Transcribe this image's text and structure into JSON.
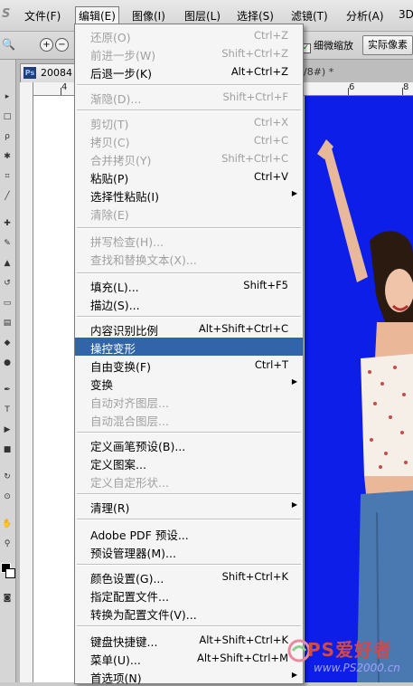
{
  "menubar": {
    "app_logo": "S",
    "items": [
      {
        "label": "文件(F)"
      },
      {
        "label": "编辑(E)"
      },
      {
        "label": "图像(I)"
      },
      {
        "label": "图层(L)"
      },
      {
        "label": "选择(S)"
      },
      {
        "label": "滤镜(T)"
      },
      {
        "label": "分析(A)"
      },
      {
        "label": "3D"
      }
    ],
    "active_item": "编辑(E)"
  },
  "options_bar": {
    "zoom_in_icon": "zoom-in-icon",
    "zoom_out_icon": "zoom-out-icon",
    "scrubby_zoom_label": "细微缩放",
    "scrubby_zoom_checked": true,
    "actual_pixels_label": "实际像素"
  },
  "document": {
    "tab_name": "20084",
    "tab_tail": "/8#) *",
    "ruler_ticks": [
      "4",
      "6",
      "8"
    ]
  },
  "edit_menu": {
    "items": [
      {
        "label": "还原(O)",
        "shortcut": "Ctrl+Z",
        "disabled": true
      },
      {
        "label": "前进一步(W)",
        "shortcut": "Shift+Ctrl+Z",
        "disabled": true
      },
      {
        "label": "后退一步(K)",
        "shortcut": "Alt+Ctrl+Z",
        "disabled": false
      },
      {
        "label": "渐隐(D)...",
        "shortcut": "Shift+Ctrl+F",
        "disabled": true
      },
      {
        "label": "剪切(T)",
        "shortcut": "Ctrl+X",
        "disabled": true
      },
      {
        "label": "拷贝(C)",
        "shortcut": "Ctrl+C",
        "disabled": true
      },
      {
        "label": "合并拷贝(Y)",
        "shortcut": "Shift+Ctrl+C",
        "disabled": true
      },
      {
        "label": "粘贴(P)",
        "shortcut": "Ctrl+V",
        "disabled": false
      },
      {
        "label": "选择性粘贴(I)",
        "shortcut": "",
        "disabled": false,
        "submenu": true
      },
      {
        "label": "清除(E)",
        "shortcut": "",
        "disabled": true
      },
      {
        "label": "拼写检查(H)...",
        "shortcut": "",
        "disabled": true
      },
      {
        "label": "查找和替换文本(X)...",
        "shortcut": "",
        "disabled": true
      },
      {
        "label": "填充(L)...",
        "shortcut": "Shift+F5",
        "disabled": false
      },
      {
        "label": "描边(S)...",
        "shortcut": "",
        "disabled": false
      },
      {
        "label": "内容识别比例",
        "shortcut": "Alt+Shift+Ctrl+C",
        "disabled": false
      },
      {
        "label": "操控变形",
        "shortcut": "",
        "disabled": false,
        "highlighted": true
      },
      {
        "label": "自由变换(F)",
        "shortcut": "Ctrl+T",
        "disabled": false
      },
      {
        "label": "变换",
        "shortcut": "",
        "disabled": false,
        "submenu": true
      },
      {
        "label": "自动对齐图层...",
        "shortcut": "",
        "disabled": true
      },
      {
        "label": "自动混合图层...",
        "shortcut": "",
        "disabled": true
      },
      {
        "label": "定义画笔预设(B)...",
        "shortcut": "",
        "disabled": false
      },
      {
        "label": "定义图案...",
        "shortcut": "",
        "disabled": false
      },
      {
        "label": "定义自定形状...",
        "shortcut": "",
        "disabled": true
      },
      {
        "label": "清理(R)",
        "shortcut": "",
        "disabled": false,
        "submenu": true
      },
      {
        "label": "Adobe PDF 预设...",
        "shortcut": "",
        "disabled": false
      },
      {
        "label": "预设管理器(M)...",
        "shortcut": "",
        "disabled": false
      },
      {
        "label": "颜色设置(G)...",
        "shortcut": "Shift+Ctrl+K",
        "disabled": false
      },
      {
        "label": "指定配置文件...",
        "shortcut": "",
        "disabled": false
      },
      {
        "label": "转换为配置文件(V)...",
        "shortcut": "",
        "disabled": false
      },
      {
        "label": "键盘快捷键...",
        "shortcut": "Alt+Shift+Ctrl+K",
        "disabled": false
      },
      {
        "label": "菜单(U)...",
        "shortcut": "Alt+Shift+Ctrl+M",
        "disabled": false
      },
      {
        "label": "首选项(N)",
        "shortcut": "",
        "disabled": false,
        "submenu": true
      }
    ]
  },
  "watermark": {
    "text": "PS爱好者",
    "url": "www.PS2000.cn"
  },
  "colors": {
    "canvas_blue": "#0c1ee8",
    "menu_highlight": "#3164a8",
    "menu_disabled_text": "#a0a0a0"
  }
}
